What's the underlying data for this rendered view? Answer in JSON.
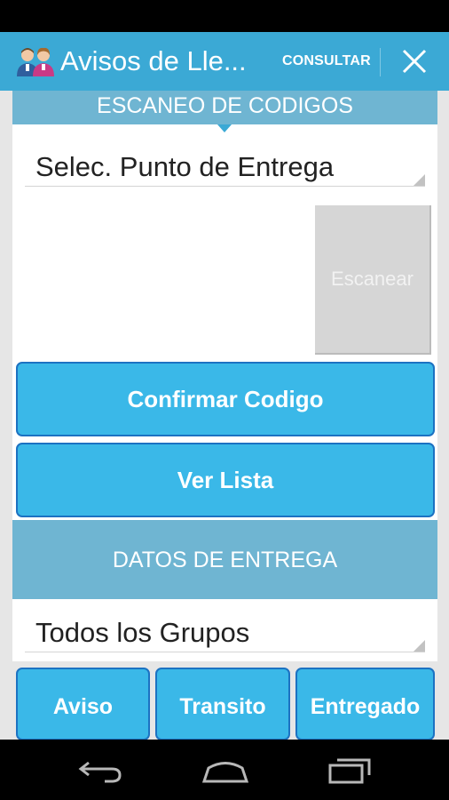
{
  "action_bar": {
    "title": "Avisos de Lle...",
    "consultar_label": "CONSULTAR",
    "app_icon": "people-icon",
    "close_icon": "close-icon",
    "color": "#3ba9d5"
  },
  "scan_section": {
    "header": "ESCANEO DE CODIGOS",
    "delivery_point_spinner": "Selec. Punto de Entrega",
    "scan_button": "Escanear",
    "confirm_button": "Confirmar Codigo",
    "list_button": "Ver Lista"
  },
  "delivery_section": {
    "header": "DATOS DE ENTREGA",
    "group_spinner": "Todos los Grupos",
    "status_buttons": [
      "Aviso",
      "Transito",
      "Entregado"
    ]
  },
  "nav_bar": {
    "icons": [
      "back-icon",
      "home-icon",
      "recent-apps-icon"
    ]
  },
  "colors": {
    "header_bg": "#6fb5d2",
    "button_bg": "#3ab8e8",
    "button_border": "#1c72c2"
  }
}
